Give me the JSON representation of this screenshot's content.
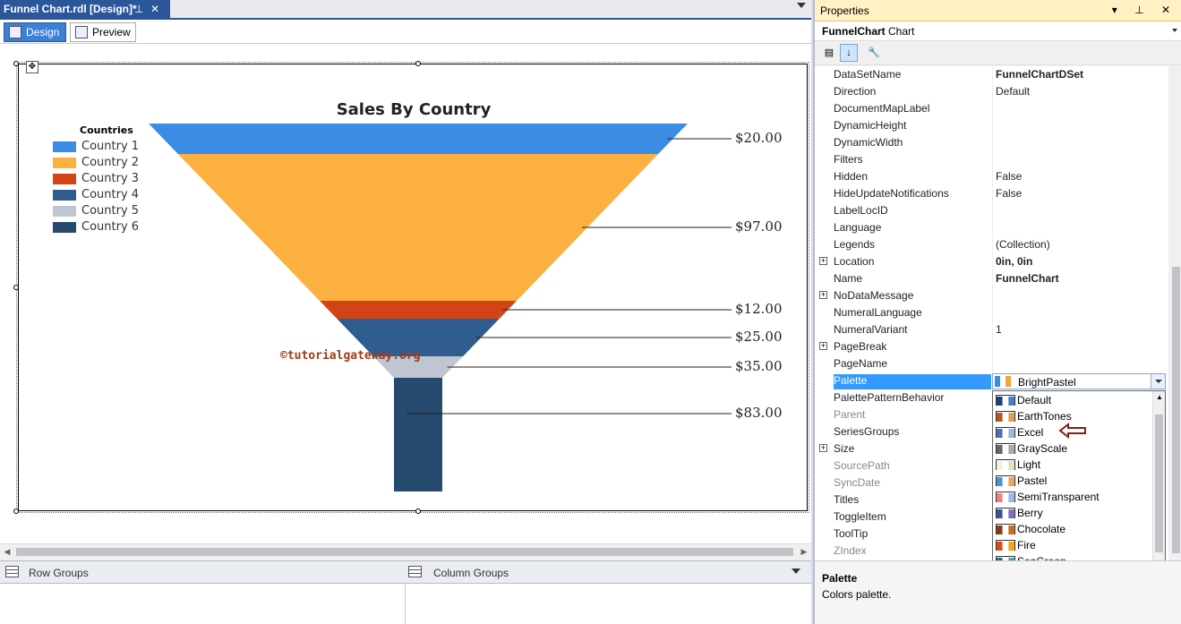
{
  "document": {
    "tab_title": "Funnel Chart.rdl [Design]*",
    "pin_glyph": "⊥",
    "close_glyph": "✕",
    "modes": [
      {
        "label": "Design",
        "active": true
      },
      {
        "label": "Preview",
        "active": false
      }
    ],
    "groups": {
      "row_label": "Row Groups",
      "column_label": "Column Groups"
    }
  },
  "chart_data": {
    "type": "funnel",
    "title": "Sales By Country",
    "legend_title": "Countries",
    "legend_position": "left",
    "series": [
      {
        "name": "Country 1",
        "value": 20,
        "label": "$20.00",
        "color": "#3a8ce4"
      },
      {
        "name": "Country 2",
        "value": 97,
        "label": "$97.00",
        "color": "#fbb040"
      },
      {
        "name": "Country 3",
        "value": 12,
        "label": "$12.00",
        "color": "#d24315"
      },
      {
        "name": "Country 4",
        "value": 25,
        "label": "$25.00",
        "color": "#2f5d90"
      },
      {
        "name": "Country 5",
        "value": 35,
        "label": "$35.00",
        "color": "#c0c6d1"
      },
      {
        "name": "Country 6",
        "value": 83,
        "label": "$83.00",
        "color": "#264a6e"
      }
    ],
    "watermark": "©tutorialgateway.org"
  },
  "properties": {
    "window_title": "Properties",
    "window_buttons": "▾ ⊥ ✕",
    "object_name": "FunnelChart",
    "object_type": "Chart",
    "rows": [
      {
        "name": "DataSetName",
        "value": "FunnelChartDSet",
        "bold": true
      },
      {
        "name": "Direction",
        "value": "Default"
      },
      {
        "name": "DocumentMapLabel",
        "value": ""
      },
      {
        "name": "DynamicHeight",
        "value": ""
      },
      {
        "name": "DynamicWidth",
        "value": ""
      },
      {
        "name": "Filters",
        "value": ""
      },
      {
        "name": "Hidden",
        "value": "False"
      },
      {
        "name": "HideUpdateNotifications",
        "value": "False"
      },
      {
        "name": "LabelLocID",
        "value": ""
      },
      {
        "name": "Language",
        "value": ""
      },
      {
        "name": "Legends",
        "value": "(Collection)"
      },
      {
        "name": "Location",
        "value": "0in, 0in",
        "bold": true,
        "expand": true
      },
      {
        "name": "Name",
        "value": "FunnelChart",
        "bold": true
      },
      {
        "name": "NoDataMessage",
        "value": "",
        "expand": true
      },
      {
        "name": "NumeralLanguage",
        "value": ""
      },
      {
        "name": "NumeralVariant",
        "value": "1"
      },
      {
        "name": "PageBreak",
        "value": "",
        "expand": true
      },
      {
        "name": "PageName",
        "value": ""
      },
      {
        "name": "Palette",
        "value": "",
        "selected": true
      },
      {
        "name": "PalettePatternBehavior",
        "value": ""
      },
      {
        "name": "Parent",
        "value": "",
        "disabled": true
      },
      {
        "name": "SeriesGroups",
        "value": ""
      },
      {
        "name": "Size",
        "value": "",
        "expand": true
      },
      {
        "name": "SourcePath",
        "value": "",
        "disabled": true
      },
      {
        "name": "SyncDate",
        "value": "",
        "disabled": true
      },
      {
        "name": "Titles",
        "value": ""
      },
      {
        "name": "ToggleItem",
        "value": ""
      },
      {
        "name": "ToolTip",
        "value": ""
      },
      {
        "name": "ZIndex",
        "value": "",
        "disabled": true
      }
    ],
    "palette_editor_value": "BrightPastel",
    "palette_options": [
      {
        "label": "Default",
        "colors": [
          "#1f3d7a",
          "#ffffff",
          "#4d7cc7"
        ]
      },
      {
        "label": "EarthTones",
        "colors": [
          "#b8561c",
          "#ffffff",
          "#e3a04c"
        ]
      },
      {
        "label": "Excel",
        "colors": [
          "#4a6fb8",
          "#ffffff",
          "#9fb5dd"
        ]
      },
      {
        "label": "GrayScale",
        "colors": [
          "#666666",
          "#ffffff",
          "#aaaaaa"
        ]
      },
      {
        "label": "Light",
        "colors": [
          "#f4f1d8",
          "#ffffff",
          "#e8e0b8"
        ]
      },
      {
        "label": "Pastel",
        "colors": [
          "#4f8fd6",
          "#ffffff",
          "#f3a35f"
        ]
      },
      {
        "label": "SemiTransparent",
        "colors": [
          "#f08080",
          "#ffffff",
          "#9db9e6"
        ]
      },
      {
        "label": "Berry",
        "colors": [
          "#3c4fa0",
          "#ffffff",
          "#7c6fc2"
        ]
      },
      {
        "label": "Chocolate",
        "colors": [
          "#8c3a14",
          "#ffffff",
          "#c86a2c"
        ]
      },
      {
        "label": "Fire",
        "colors": [
          "#e24a12",
          "#ffffff",
          "#f7a41a"
        ]
      },
      {
        "label": "SeaGreen",
        "colors": [
          "#2d6b7a",
          "#ffffff",
          "#4fa39b"
        ]
      },
      {
        "label": "BrightPastel",
        "colors": [
          "#3c8ae0",
          "#ffffff",
          "#f5a33a"
        ],
        "selected": true
      }
    ],
    "description_title": "Palette",
    "description_text": "Colors palette."
  },
  "colors": {
    "accent": "#3399ff",
    "tab_active": "#2b579a",
    "arrow": "#8b1a1a"
  }
}
